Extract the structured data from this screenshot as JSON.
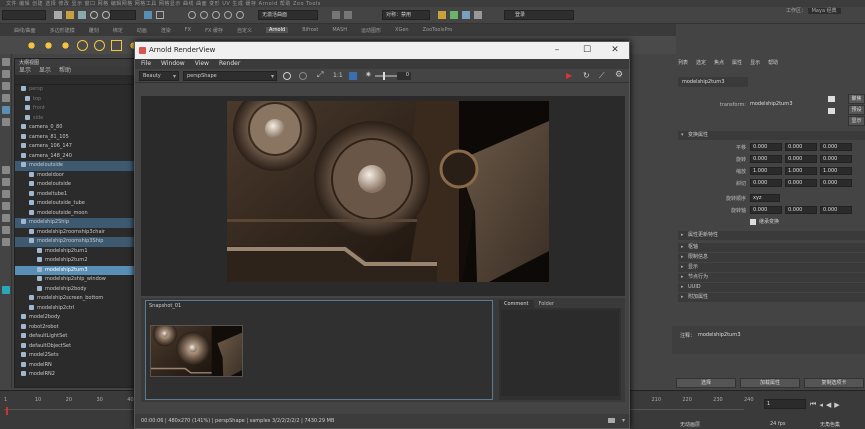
{
  "maya": {
    "menubar": [
      "文件",
      "编辑",
      "创建",
      "选择",
      "修改",
      "显示",
      "窗口",
      "网格",
      "编辑网格",
      "网格工具",
      "网格显示",
      "曲线",
      "曲面",
      "变形",
      "UV",
      "生成",
      "缓存",
      "Arnold",
      "帮助",
      "Zoo Tools"
    ],
    "workspace_label": "工作区：",
    "workspace_value": "Maya 经典",
    "live_surface": "无激活曲面",
    "symmetry": "对称：禁用",
    "login": "登录",
    "shelf_tabs": [
      "曲线/曲面",
      "多边形建模",
      "雕刻",
      "绑定",
      "动画",
      "渲染",
      "FX",
      "FX 缓存",
      "自定义",
      "Arnold",
      "Bifrost",
      "MASH",
      "运动图形",
      "XGen",
      "ZooToolsPro"
    ]
  },
  "outliner": {
    "title": "大纲视图",
    "menu": [
      "显示",
      "显示",
      "帮助"
    ],
    "items": [
      {
        "label": "persp",
        "dim": true
      },
      {
        "label": "top",
        "dim": true
      },
      {
        "label": "front",
        "dim": true
      },
      {
        "label": "side",
        "dim": true
      },
      {
        "label": "camera_0_80"
      },
      {
        "label": "camera_81_105"
      },
      {
        "label": "camera_106_147"
      },
      {
        "label": "camera_148_240"
      },
      {
        "label": "modeloutside",
        "hl": true
      },
      {
        "label": "modeldoor"
      },
      {
        "label": "modeloutside"
      },
      {
        "label": "modeltube1"
      },
      {
        "label": "modeloutside_tube"
      },
      {
        "label": "modeloutside_moon"
      },
      {
        "label": "modelship2Ship",
        "hl": true
      },
      {
        "label": "modelship2roomship3chair"
      },
      {
        "label": "modelship2roomship3Ship",
        "hl": true
      },
      {
        "label": "modelship2turn1"
      },
      {
        "label": "modelship2turn2"
      },
      {
        "label": "modelship2turn3",
        "sel": true
      },
      {
        "label": "modelship2ship_window"
      },
      {
        "label": "modelship2body"
      },
      {
        "label": "modelship2screen_bottom"
      },
      {
        "label": "modelship2ctrl"
      },
      {
        "label": "model2body"
      },
      {
        "label": "robot2robot"
      },
      {
        "label": "defaultLightSet"
      },
      {
        "label": "defaultObjectSet"
      },
      {
        "label": "model2Sets"
      },
      {
        "label": "modelRN"
      },
      {
        "label": "modelRN2"
      }
    ]
  },
  "renderview": {
    "title": "Arnold RenderView",
    "menu": [
      "File",
      "Window",
      "View",
      "Render"
    ],
    "aov": "Beauty",
    "camera": "perspShape",
    "ratio": "1:1",
    "exposure": "0",
    "snapshot_label": "Snapshot_01",
    "comment_tab": "Comment",
    "folder_tab": "Folder",
    "status": "00:00:06 | 480x270 (141%) | perspShape | samples 3/2/2/2/2/2 | 7430.29 MB"
  },
  "attr": {
    "tabs": [
      "列表",
      "选定",
      "焦点",
      "属性",
      "显示",
      "帮助"
    ],
    "node_tab": "modelship2turn3",
    "transform_label": "transform:",
    "transform_value": "modelship2turn3",
    "focus_btn": "聚焦",
    "preset_btn": "预设",
    "show_btn": "显示",
    "hide_btn": "隐藏",
    "section_transform": "变换属性",
    "rows": [
      {
        "label": "平移",
        "v": [
          "0.000",
          "0.000",
          "0.000"
        ]
      },
      {
        "label": "旋转",
        "v": [
          "0.000",
          "0.000",
          "0.000"
        ]
      },
      {
        "label": "缩放",
        "v": [
          "1.000",
          "1.000",
          "1.000"
        ]
      },
      {
        "label": "斜切",
        "v": [
          "0.000",
          "0.000",
          "0.000"
        ]
      }
    ],
    "rot_order_label": "旋转顺序",
    "rot_order": "xyz",
    "rot_axis_label": "旋转轴",
    "rot_axis": [
      "0.000",
      "0.000",
      "0.000"
    ],
    "inherit": "继承变换",
    "sections": [
      "枢轴",
      "限制信息",
      "显示",
      "节点行为",
      "UUID",
      "附加属性"
    ],
    "pivot_section": "属性更新特性",
    "note_label": "注释：",
    "note_value": "modelship2turn3",
    "btn_select": "选择",
    "btn_load": "加载属性",
    "btn_copy": "复制选项卡"
  },
  "timeline": {
    "ticks": [
      "1",
      "10",
      "20",
      "30",
      "40",
      "50",
      "60",
      "70",
      "80",
      "90",
      "100",
      "110",
      "120",
      "130",
      "140",
      "150",
      "160",
      "170",
      "180",
      "190",
      "200",
      "210",
      "220",
      "230",
      "240"
    ],
    "current_frame": "1",
    "fps": "24 fps",
    "anim_layer": "无动画层",
    "char_set": "无角色集"
  }
}
